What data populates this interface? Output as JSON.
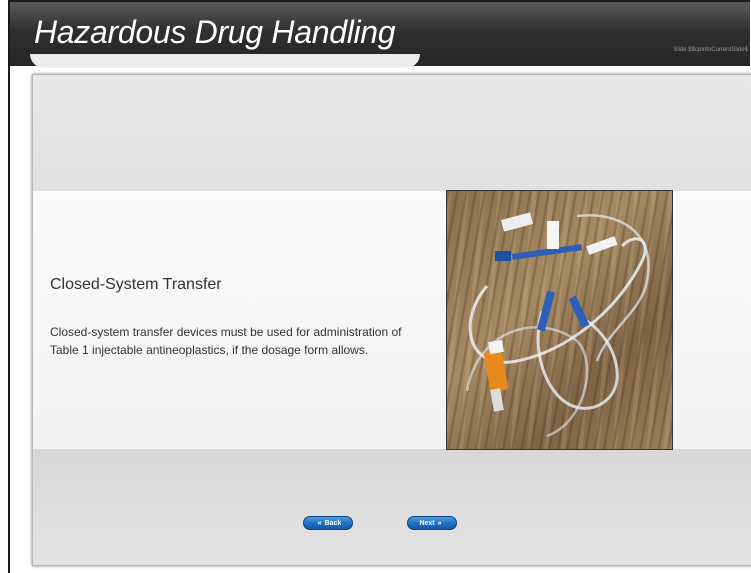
{
  "header": {
    "title": "Hazardous Drug Handling",
    "slide_counter": "Slide $$cpInfoCurrentSlide$"
  },
  "slide": {
    "heading": "Closed-System Transfer",
    "body": "Closed-system transfer devices must be used for administration of Table 1 injectable antineoplastics, if the dosage form allows."
  },
  "nav": {
    "back_label": "Back",
    "back_icon": "double-chevron-left-icon",
    "next_label": "Next",
    "next_icon": "double-chevron-right-icon"
  },
  "colors": {
    "header_bg": "#2f2f2f",
    "button_blue": "#1f6fc4",
    "text": "#333333"
  }
}
